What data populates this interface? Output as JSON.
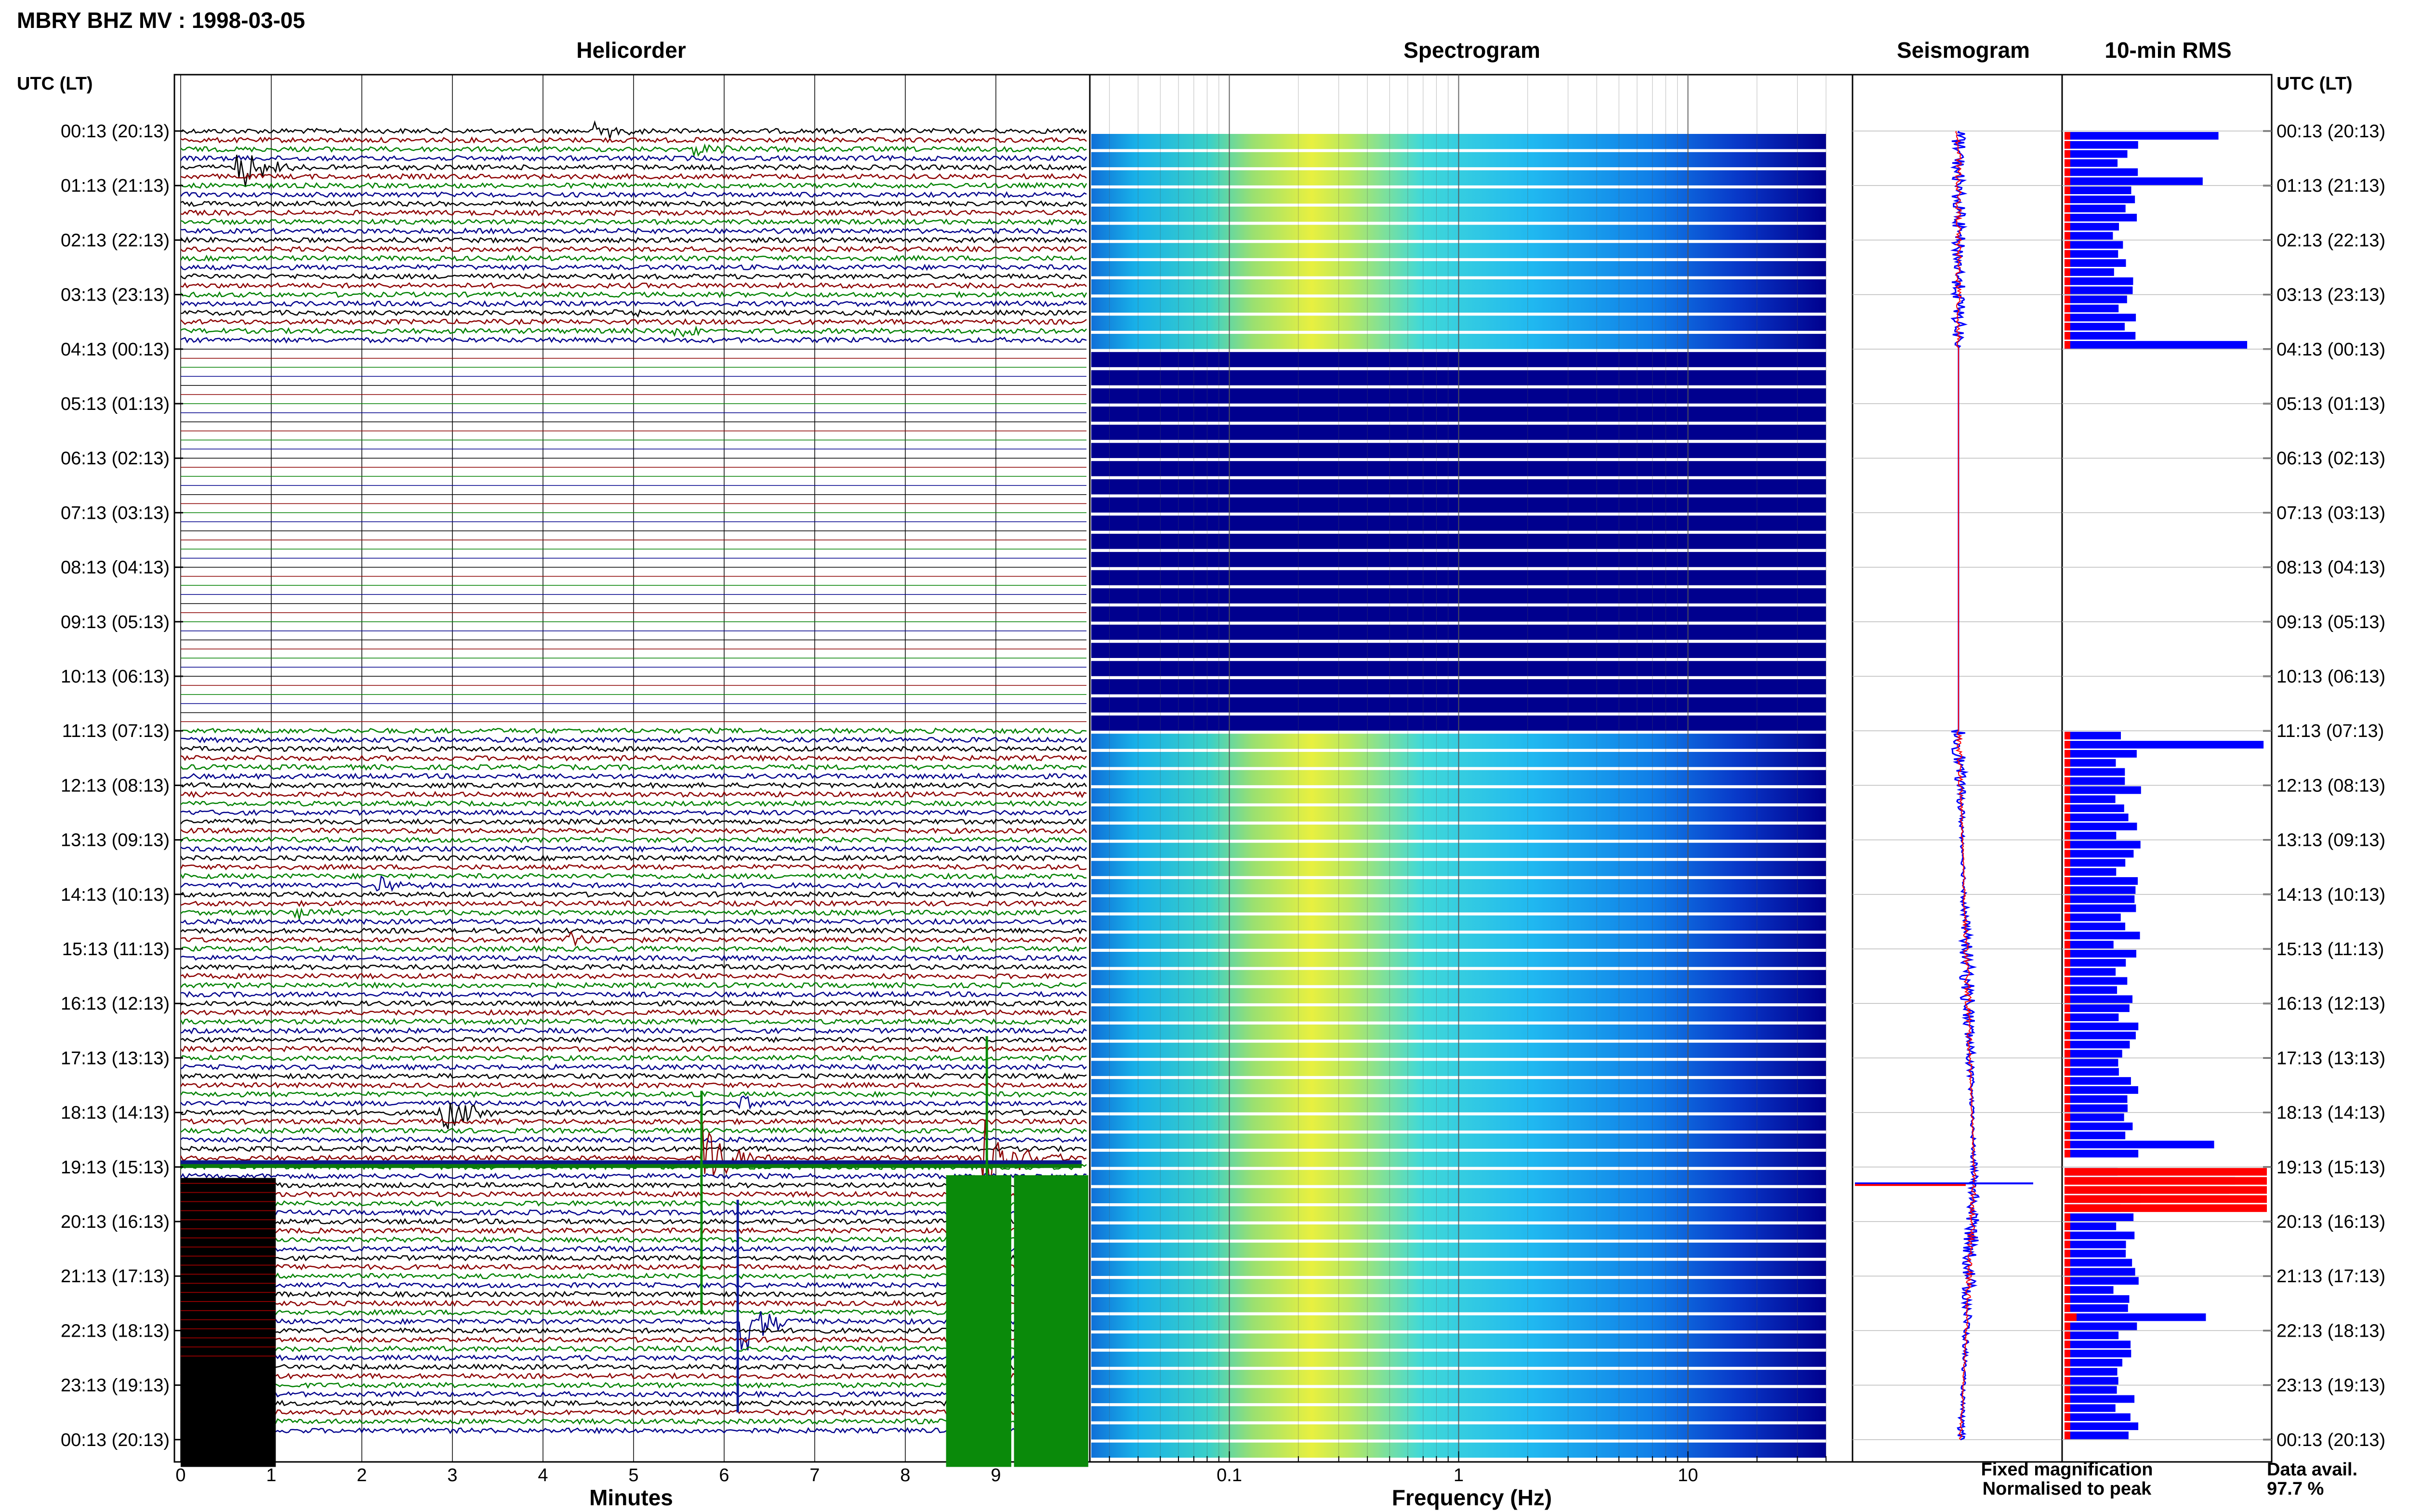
{
  "header": {
    "title": "MBRY BHZ MV : 1998-03-05"
  },
  "panels": {
    "helicorder": "Helicorder",
    "spectrogram": "Spectrogram",
    "seismogram": "Seismogram",
    "rms": "10-min RMS"
  },
  "axes": {
    "left_header": "UTC (LT)",
    "right_header": "UTC (LT)",
    "x_minutes_label": "Minutes",
    "x_frequency_label": "Frequency (Hz)"
  },
  "legend": {
    "fixed": "Fixed magnification",
    "normalised": "Normalised to peak",
    "fixed_color": "#0000ff",
    "normalised_color": "#ff0000"
  },
  "data_availability": {
    "label": "Data avail.",
    "value": "97.7 %"
  },
  "chart_data": {
    "type": "helicorder",
    "time_ticks": [
      "00:13 (20:13)",
      "01:13 (21:13)",
      "02:13 (22:13)",
      "03:13 (23:13)",
      "04:13 (00:13)",
      "05:13 (01:13)",
      "06:13 (02:13)",
      "07:13 (03:13)",
      "08:13 (04:13)",
      "09:13 (05:13)",
      "10:13 (06:13)",
      "11:13 (07:13)",
      "12:13 (08:13)",
      "13:13 (09:13)",
      "14:13 (10:13)",
      "15:13 (11:13)",
      "16:13 (12:13)",
      "17:13 (13:13)",
      "18:13 (14:13)",
      "19:13 (15:13)",
      "20:13 (16:13)",
      "21:13 (17:13)",
      "22:13 (18:13)",
      "23:13 (19:13)",
      "00:13 (20:13)"
    ],
    "minutes_ticks": [
      "0",
      "1",
      "2",
      "3",
      "4",
      "5",
      "6",
      "7",
      "8",
      "9"
    ],
    "minutes_range": [
      0,
      10
    ],
    "frequency_ticks": [
      "0.1",
      "1",
      "10"
    ],
    "frequency_range": [
      0.025,
      40
    ],
    "frequency_scale": "log",
    "trace_colors": [
      "#000000",
      "#8b0000",
      "#008000",
      "#00008b"
    ],
    "gap_hours": [
      4.0,
      11.0
    ],
    "events": [
      {
        "hour": 0.05,
        "minute": 4.6,
        "amp": 0.8
      },
      {
        "hour": 0.67,
        "minute": 0.65,
        "amp": 1.8
      },
      {
        "hour": 0.33,
        "minute": 5.7,
        "amp": 0.4
      },
      {
        "hour": 3.6,
        "minute": 5.5,
        "amp": 0.5
      },
      {
        "hour": 3.4,
        "minute": 4.8,
        "amp": 0.3
      },
      {
        "hour": 13.83,
        "minute": 2.2,
        "amp": 0.6
      },
      {
        "hour": 14.33,
        "minute": 1.3,
        "amp": 0.6
      },
      {
        "hour": 14.83,
        "minute": 4.3,
        "amp": 0.7
      },
      {
        "hour": 18.0,
        "minute": 2.9,
        "amp": 1.5
      },
      {
        "hour": 17.8,
        "minute": 6.2,
        "amp": 0.5
      },
      {
        "hour": 18.83,
        "minute": 5.8,
        "amp": 3.0
      },
      {
        "hour": 18.83,
        "minute": 8.9,
        "amp": 4.5
      },
      {
        "hour": 21.83,
        "minute": 6.2,
        "amp": 2.6
      }
    ],
    "rms": {
      "intervals_per_hour": 6,
      "gap_hours": [
        [
          4.0,
          11.0
        ],
        [
          18.67,
          19.0
        ]
      ],
      "spike_hours": [
        0.0,
        0.83,
        3.83,
        11.17,
        18.5,
        19.17,
        19.33,
        21.67
      ]
    },
    "legend_position": "bottom-right"
  }
}
